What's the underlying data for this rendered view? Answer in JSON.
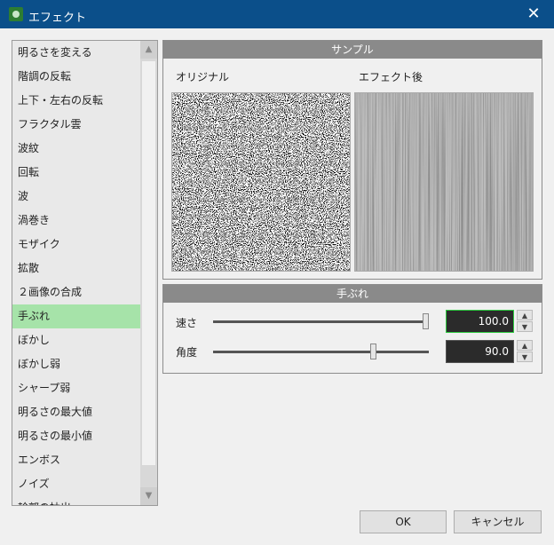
{
  "window": {
    "title": "エフェクト"
  },
  "effects": [
    "明るさを変える",
    "階調の反転",
    "上下・左右の反転",
    "フラクタル雲",
    "波紋",
    "回転",
    "波",
    "渦巻き",
    "モザイク",
    "拡散",
    "２画像の合成",
    "手ぶれ",
    "ぼかし",
    "ぼかし弱",
    "シャープ弱",
    "明るさの最大値",
    "明るさの最小値",
    "エンボス",
    "ノイズ",
    "輪郭の抽出"
  ],
  "selected_effect": "手ぶれ",
  "sample": {
    "header": "サンプル",
    "original_label": "オリジナル",
    "after_label": "エフェクト後"
  },
  "shake": {
    "header": "手ぶれ",
    "speed": {
      "label": "速さ",
      "value": "100.0",
      "level": 1.0
    },
    "angle": {
      "label": "角度",
      "value": "90.0",
      "level": 0.75
    }
  },
  "buttons": {
    "ok": "OK",
    "cancel": "キャンセル"
  }
}
